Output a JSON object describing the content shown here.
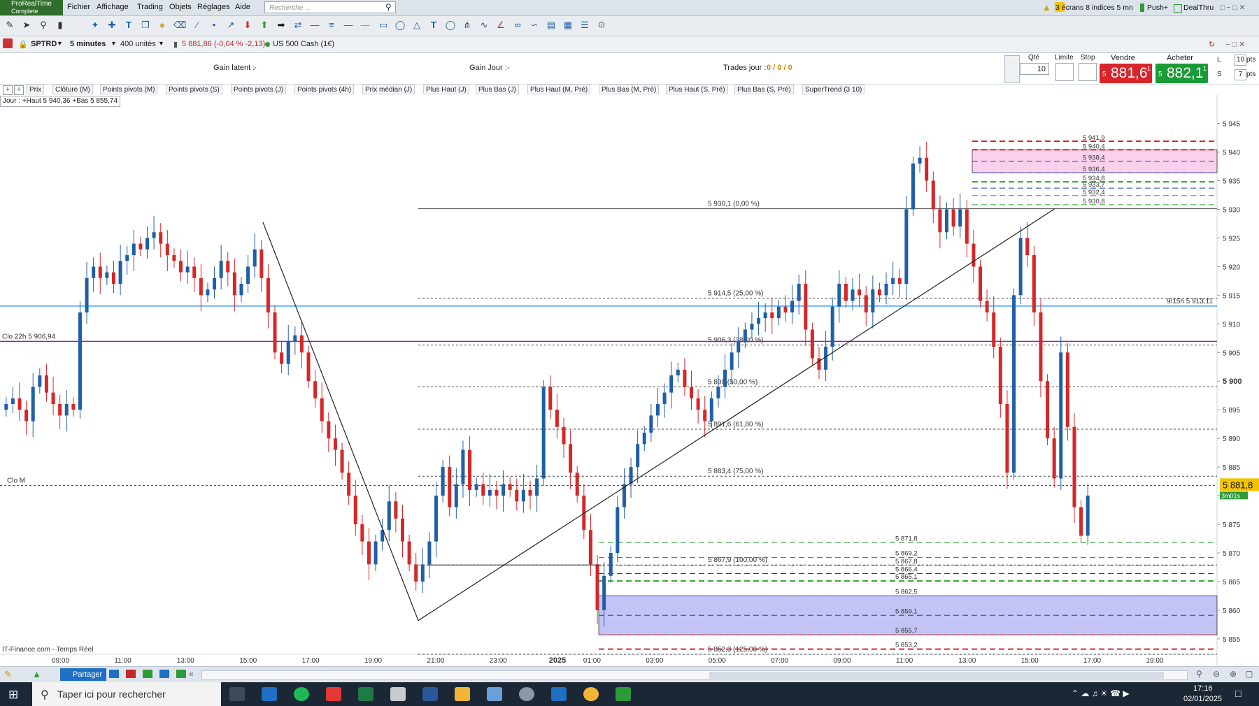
{
  "app": {
    "logo_line1": "ProRealTime",
    "logo_line2": "Complete"
  },
  "menu": [
    "Fichier",
    "Affichage",
    "Trading",
    "Objets",
    "Réglages",
    "Aide"
  ],
  "search_placeholder": "Recherche ...",
  "top_right": {
    "screens": "3 écrans 8 indices 5 mn",
    "push": "Push+",
    "dealthru": "DealThru"
  },
  "instrument": {
    "symbol": "SPTRD",
    "timeframe": "5 minutes",
    "units": "400 unités",
    "quote": "5 881,86 (-0,04 % -2,13)",
    "name": "US 500 Cash (1€)"
  },
  "info": {
    "gain_latent": "Gain latent :",
    "gain_latent_val": "-",
    "gain_jour": "Gain Jour :",
    "gain_jour_val": "-",
    "trades_jour": "Trades jour :",
    "trades_jour_val": "0 / 0 / 0"
  },
  "order_panel": {
    "qte_label": "Qté",
    "qte_value": "10",
    "limite": "Limite",
    "stop": "Stop",
    "vendre": "Vendre",
    "acheter": "Acheter",
    "sell_prefix": "5",
    "sell_price": "881,6",
    "sell_sup": "1",
    "buy_prefix": "5",
    "buy_price": "882,1",
    "buy_sup": "1",
    "l_label": "L",
    "l_value": "10",
    "s_label": "S",
    "s_value": "7",
    "pts": "pts"
  },
  "indicators": [
    "Prix",
    "Clôture (M)",
    "Points pivots (M)",
    "Points pivots (S)",
    "Points pivots (J)",
    "Points pivots (4h)",
    "Prix médian (J)",
    "Plus Haut (J)",
    "Plus Bas (J)",
    "Plus Haut (M, Pré)",
    "Plus Bas (M, Pré)",
    "Plus Haut (S, Pré)",
    "Plus Bas (S, Pré)",
    "SuperTrend (3 10)"
  ],
  "chart_data": {
    "type": "candlestick",
    "header_label": "Jour : +Haut 5 940,36 +Bas 5 855,74",
    "source_label": "IT-Finance.com - Temps Réel",
    "y_ticks": [
      5855,
      5860,
      5865,
      5870,
      5875,
      5880,
      5885,
      5890,
      5895,
      5900,
      5905,
      5910,
      5915,
      5920,
      5925,
      5930,
      5935,
      5940,
      5945
    ],
    "y_tick_labels": [
      "5 855",
      "5 860",
      "5 865",
      "5 870",
      "5 875",
      "5 880",
      "5 885",
      "5 890",
      "5 895",
      "5 900",
      "5 905",
      "5 910",
      "5 915",
      "5 920",
      "5 925",
      "5 930",
      "5 935",
      "5 940",
      "5 945"
    ],
    "y_bold_tick": 5900,
    "ylim": [
      5852.3,
      5948.0
    ],
    "x_ticks": [
      "09:00",
      "11:00",
      "13:00",
      "15:00",
      "17:00",
      "19:00",
      "21:00",
      "23:00",
      "2025",
      "01:00",
      "03:00",
      "05:00",
      "07:00",
      "09:00",
      "11:00",
      "13:00",
      "15:00",
      "17:00",
      "19:00"
    ],
    "x_span": [
      0,
      24
    ],
    "x_tick_positions": [
      0,
      2,
      4,
      6,
      8,
      10,
      12,
      14,
      15.9,
      17,
      19,
      21,
      23,
      25,
      27,
      29,
      31,
      33,
      35
    ],
    "current_price": "5 881,8",
    "current_price_value": 5881.8,
    "countdown": "3m01s",
    "horizontal_lines": [
      {
        "label": "Clo 22h 5 906,94",
        "value": 5906.94,
        "color": "#8e24aa"
      },
      {
        "label": "9/15h 5 913,11",
        "value": 5913.11,
        "color": "#42a5f5"
      },
      {
        "label": "Clo M",
        "value": 5881.8,
        "color": "#333333"
      }
    ],
    "fibonacci": [
      {
        "label": "5 930,1 (0,00 %)",
        "value": 5930.1
      },
      {
        "label": "5 914,5 (25,00 %)",
        "value": 5914.5
      },
      {
        "label": "5 906,3 (38,20 %)",
        "value": 5906.3
      },
      {
        "label": "5 899 (50,00 %)",
        "value": 5899.0
      },
      {
        "label": "5 891,6 (61,80 %)",
        "value": 5891.6
      },
      {
        "label": "5 883,4 (75,00 %)",
        "value": 5883.4
      },
      {
        "label": "5 867,9 (100,00 %)",
        "value": 5867.9
      },
      {
        "label": "5 852,3 (125,00 %)",
        "value": 5852.3
      }
    ],
    "pivot_labels_upper": [
      "5 941,9",
      "5 940,4",
      "5 938,4",
      "5 936,4",
      "5 934,8",
      "5 933,7",
      "5 932,4",
      "5 930,8"
    ],
    "pivot_values_upper": [
      5941.9,
      5940.4,
      5938.4,
      5936.4,
      5934.8,
      5933.7,
      5932.4,
      5930.8
    ],
    "pivot_labels_lower": [
      "5 871,8",
      "5 869,2",
      "5 867,8",
      "5 866,4",
      "5 865,1",
      "5 862,5",
      "5 859,1",
      "5 855,7",
      "5 853,2"
    ],
    "pivot_values_lower": [
      5871.8,
      5869.2,
      5867.8,
      5866.4,
      5865.1,
      5862.5,
      5859.1,
      5855.7,
      5853.2
    ],
    "zones": [
      {
        "from": 5936.4,
        "to": 5940.4,
        "color": "#f9c9ea"
      },
      {
        "from": 5855.7,
        "to": 5862.5,
        "color": "#b8b8f3"
      }
    ],
    "series_close": [
      5896,
      5897,
      5895,
      5893,
      5899,
      5901,
      5898,
      5896,
      5894,
      5896,
      5895,
      5912,
      5918,
      5920,
      5918,
      5919,
      5917,
      5921,
      5922,
      5924,
      5923,
      5925,
      5926,
      5924,
      5922,
      5921,
      5919,
      5920,
      5918,
      5915,
      5916,
      5918,
      5921,
      5919,
      5915,
      5917,
      5920,
      5923,
      5918,
      5912,
      5905,
      5903,
      5907,
      5908,
      5905,
      5900,
      5897,
      5893,
      5890,
      5888,
      5884,
      5880,
      5875,
      5872,
      5868,
      5872,
      5874,
      5879,
      5876,
      5872,
      5868,
      5865,
      5868,
      5872,
      5880,
      5885,
      5878,
      5882,
      5888,
      5881,
      5882,
      5880,
      5881,
      5880,
      5882,
      5881,
      5879,
      5881,
      5880,
      5883,
      5899,
      5895,
      5892,
      5889,
      5884,
      5880,
      5874,
      5868,
      5860,
      5866,
      5870,
      5878,
      5882,
      5885,
      5889,
      5891,
      5894,
      5896,
      5898,
      5901,
      5902,
      5899,
      5897,
      5895,
      5893,
      5897,
      5899,
      5902,
      5905,
      5907,
      5909,
      5910,
      5911,
      5912,
      5911,
      5913,
      5912,
      5914,
      5917,
      5909,
      5904,
      5902,
      5906,
      5913,
      5917,
      5914,
      5916,
      5915,
      5912,
      5916,
      5915,
      5917,
      5918,
      5917,
      5930,
      5938,
      5939,
      5935,
      5930,
      5926,
      5930,
      5927,
      5930,
      5924,
      5920,
      5914,
      5912,
      5906,
      5896,
      5884,
      5915,
      5925,
      5922,
      5912,
      5900,
      5890,
      5883,
      5905,
      5892,
      5878,
      5873,
      5880
    ]
  },
  "bottom": {
    "partager": "Partager"
  },
  "taskbar": {
    "search": "Taper ici pour rechercher",
    "time": "17:16",
    "date": "02/01/2025"
  }
}
